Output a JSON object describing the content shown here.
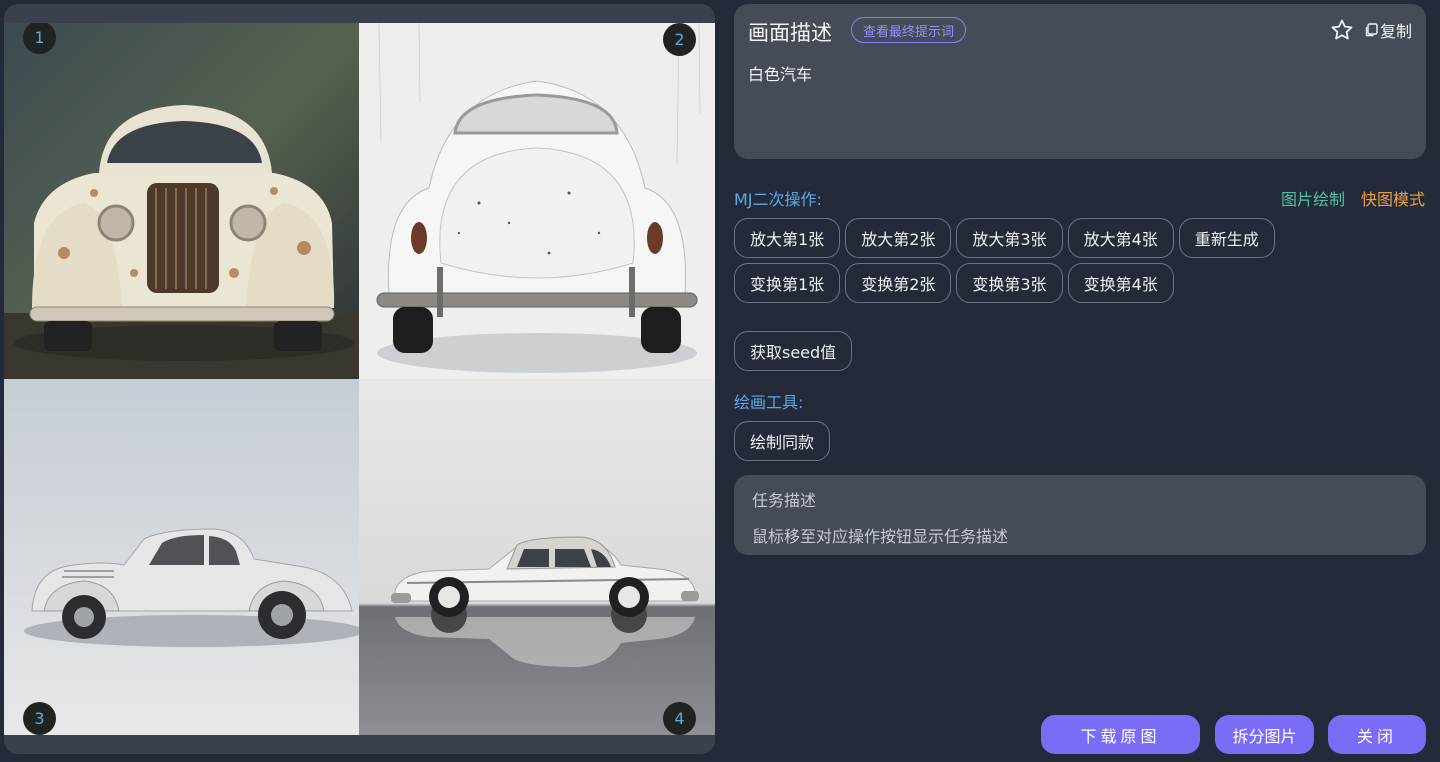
{
  "grid": {
    "badges": [
      "1",
      "2",
      "3",
      "4"
    ],
    "images": [
      "rusty-vintage-car-front",
      "white-beetle-rear",
      "white-coupe-side",
      "white-sedan-side-reflection"
    ]
  },
  "description": {
    "title": "画面描述",
    "view_prompt_label": "查看最终提示词",
    "copy_label": "复制",
    "text": "白色汽车"
  },
  "mj": {
    "label": "MJ二次操作:",
    "link_draw": "图片绘制",
    "link_fast": "快图模式",
    "upscale": [
      "放大第1张",
      "放大第2张",
      "放大第3张",
      "放大第4张",
      "重新生成"
    ],
    "variation": [
      "变换第1张",
      "变换第2张",
      "变换第3张",
      "变换第4张"
    ],
    "seed_label": "获取seed值"
  },
  "tools": {
    "label": "绘画工具:",
    "same_style_label": "绘制同款"
  },
  "task": {
    "title": "任务描述",
    "text": "鼠标移至对应操作按钮显示任务描述"
  },
  "footer": {
    "download_label": "下载原图",
    "split_label": "拆分图片",
    "close_label": "关闭"
  },
  "colors": {
    "background": "#252a3a",
    "card": "#464b58",
    "accent": "#7b6cf6",
    "section_label": "#5aa9e6",
    "link_green": "#4fbfa8",
    "link_orange": "#e9a23b"
  }
}
